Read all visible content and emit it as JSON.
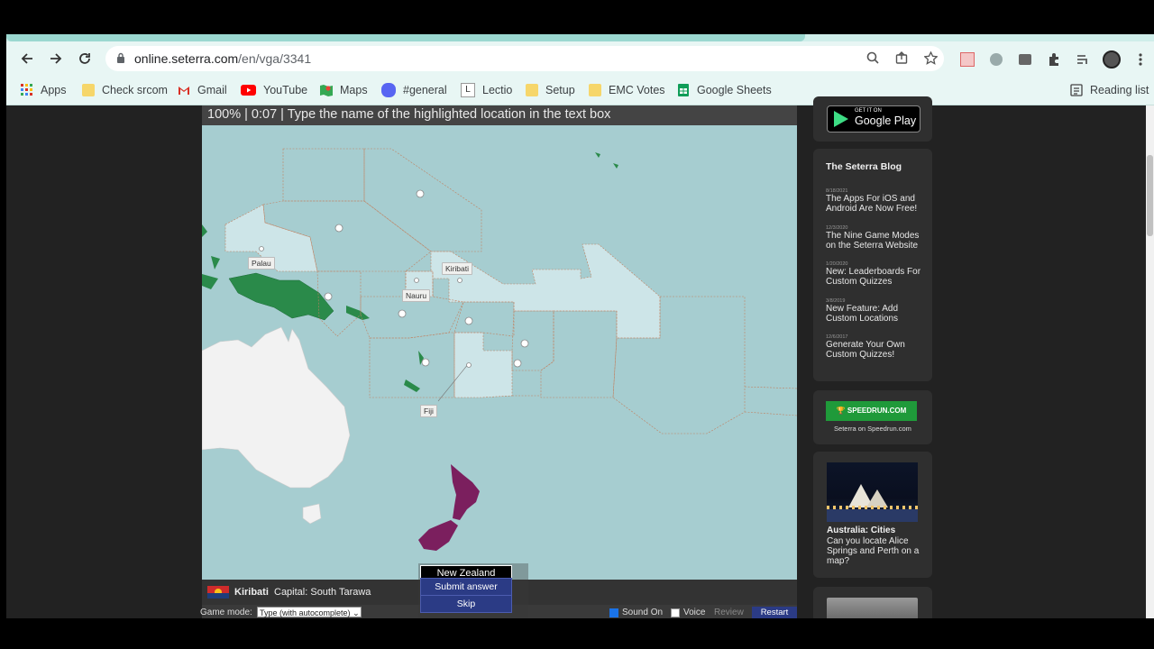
{
  "browser": {
    "url_host": "online.seterra.com",
    "url_path": "/en/vga/3341",
    "bookmarks": [
      {
        "label": "Apps",
        "icon": "apps-grid-icon"
      },
      {
        "label": "Check srcom",
        "icon": "folder-icon"
      },
      {
        "label": "Gmail",
        "icon": "gmail-icon"
      },
      {
        "label": "YouTube",
        "icon": "youtube-icon"
      },
      {
        "label": "Maps",
        "icon": "maps-icon"
      },
      {
        "label": "#general",
        "icon": "discord-icon"
      },
      {
        "label": "Lectio",
        "icon": "lectio-icon"
      },
      {
        "label": "Setup",
        "icon": "folder-icon"
      },
      {
        "label": "EMC Votes",
        "icon": "folder-icon"
      },
      {
        "label": "Google Sheets",
        "icon": "sheets-icon"
      }
    ],
    "reading_list": "Reading list"
  },
  "game": {
    "progress": "100%",
    "time": "0:07",
    "instruction": "Type the name of the highlighted location in the text box",
    "labels": {
      "palau": "Palau",
      "nauru": "Nauru",
      "kiribati": "Kiribati",
      "fiji": "Fiji"
    },
    "info": {
      "country": "Kiribati",
      "capital": "Capital: South Tarawa"
    },
    "answer_value": "New Zealand",
    "submit_label": "Submit answer",
    "skip_label": "Skip",
    "game_mode_label": "Game mode:",
    "game_mode_value": "Type (with autocomplete)",
    "sound_label": "Sound On",
    "voice_label": "Voice",
    "review_label": "Review",
    "restart_label": "Restart",
    "colors": {
      "highlight": "#7b1f5e",
      "land": "#2a8a4a",
      "sea": "#a6cdd0",
      "australia": "#f2f2f2"
    }
  },
  "sidebar": {
    "gplay_small": "GET IT ON",
    "gplay_big": "Google Play",
    "blog_title": "The Seterra Blog",
    "posts": [
      {
        "date": "8/18/2021",
        "title": "The Apps For iOS and Android Are Now Free!"
      },
      {
        "date": "12/3/2020",
        "title": "The Nine Game Modes on the Seterra Website"
      },
      {
        "date": "1/20/2020",
        "title": "New: Leaderboards For Custom Quizzes"
      },
      {
        "date": "3/8/2019",
        "title": "New Feature: Add Custom Locations"
      },
      {
        "date": "12/6/2017",
        "title": "Generate Your Own Custom Quizzes!"
      }
    ],
    "speedrun_logo": "SPEEDRUN.COM",
    "speedrun_caption": "Seterra on Speedrun.com",
    "promo_title": "Australia: Cities",
    "promo_desc": "Can you locate Alice Springs and Perth on a map?"
  }
}
